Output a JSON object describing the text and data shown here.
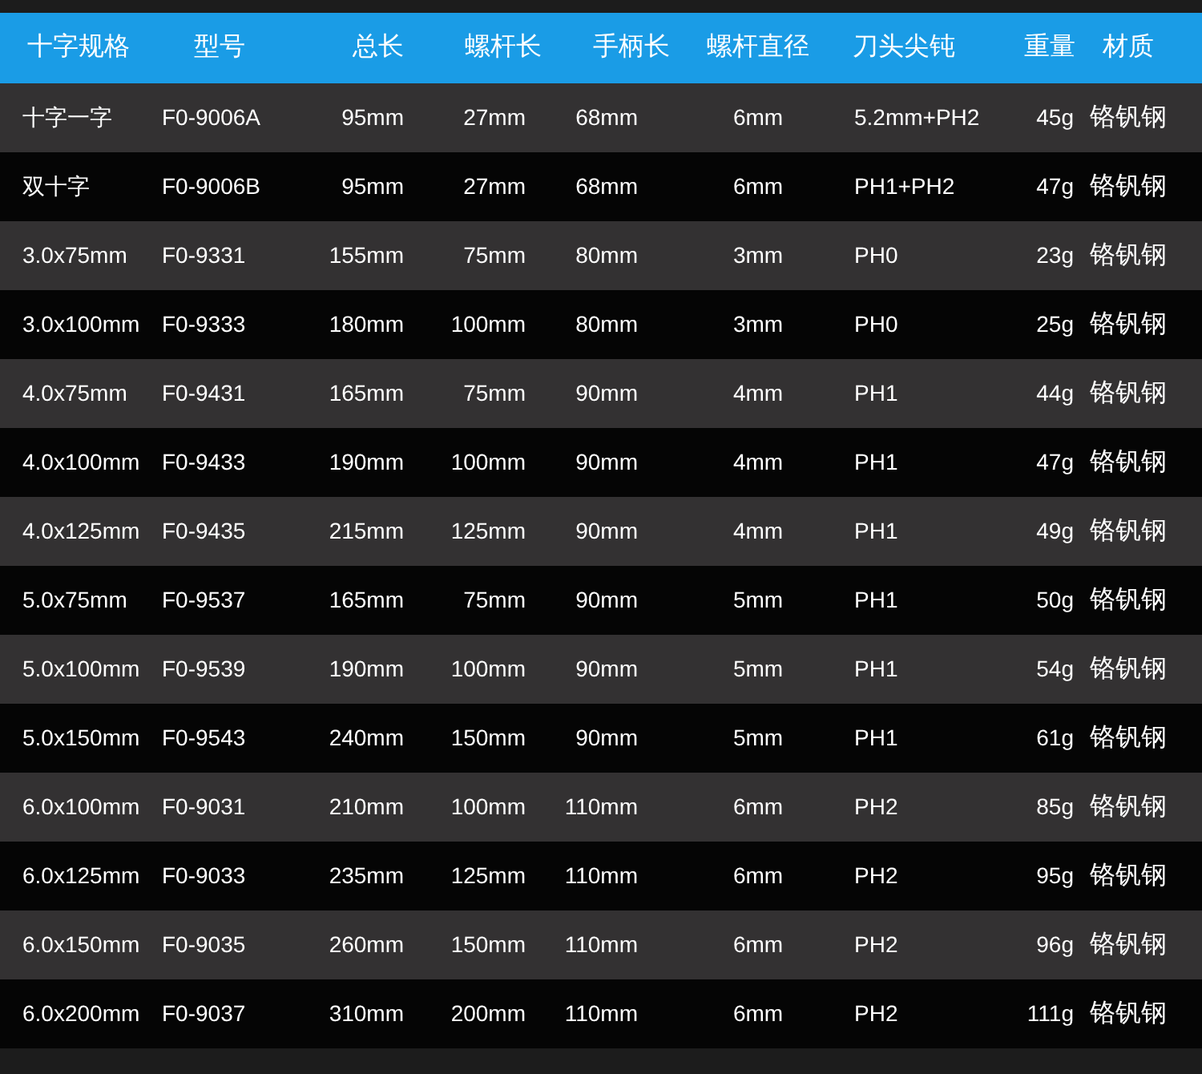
{
  "table": {
    "columns": [
      "十字规格",
      "型号",
      "总长",
      "螺杆长",
      "手柄长",
      "螺杆直径",
      "刀头尖钝",
      "重量",
      "材质"
    ],
    "rows": [
      [
        "十字一字",
        "F0-9006A",
        "95mm",
        "27mm",
        "68mm",
        "6mm",
        "5.2mm+PH2",
        "45g",
        "铬钒钢"
      ],
      [
        "双十字",
        "F0-9006B",
        "95mm",
        "27mm",
        "68mm",
        "6mm",
        "PH1+PH2",
        "47g",
        "铬钒钢"
      ],
      [
        "3.0x75mm",
        "F0-9331",
        "155mm",
        "75mm",
        "80mm",
        "3mm",
        "PH0",
        "23g",
        "铬钒钢"
      ],
      [
        "3.0x100mm",
        "F0-9333",
        "180mm",
        "100mm",
        "80mm",
        "3mm",
        "PH0",
        "25g",
        "铬钒钢"
      ],
      [
        "4.0x75mm",
        "F0-9431",
        "165mm",
        "75mm",
        "90mm",
        "4mm",
        "PH1",
        "44g",
        "铬钒钢"
      ],
      [
        "4.0x100mm",
        "F0-9433",
        "190mm",
        "100mm",
        "90mm",
        "4mm",
        "PH1",
        "47g",
        "铬钒钢"
      ],
      [
        "4.0x125mm",
        "F0-9435",
        "215mm",
        "125mm",
        "90mm",
        "4mm",
        "PH1",
        "49g",
        "铬钒钢"
      ],
      [
        "5.0x75mm",
        "F0-9537",
        "165mm",
        "75mm",
        "90mm",
        "5mm",
        "PH1",
        "50g",
        "铬钒钢"
      ],
      [
        "5.0x100mm",
        "F0-9539",
        "190mm",
        "100mm",
        "90mm",
        "5mm",
        "PH1",
        "54g",
        "铬钒钢"
      ],
      [
        "5.0x150mm",
        "F0-9543",
        "240mm",
        "150mm",
        "90mm",
        "5mm",
        "PH1",
        "61g",
        "铬钒钢"
      ],
      [
        "6.0x100mm",
        "F0-9031",
        "210mm",
        "100mm",
        "110mm",
        "6mm",
        "PH2",
        "85g",
        "铬钒钢"
      ],
      [
        "6.0x125mm",
        "F0-9033",
        "235mm",
        "125mm",
        "110mm",
        "6mm",
        "PH2",
        "95g",
        "铬钒钢"
      ],
      [
        "6.0x150mm",
        "F0-9035",
        "260mm",
        "150mm",
        "110mm",
        "6mm",
        "PH2",
        "96g",
        "铬钒钢"
      ],
      [
        "6.0x200mm",
        "F0-9037",
        "310mm",
        "200mm",
        "110mm",
        "6mm",
        "PH2",
        "111g",
        "铬钒钢"
      ]
    ]
  }
}
